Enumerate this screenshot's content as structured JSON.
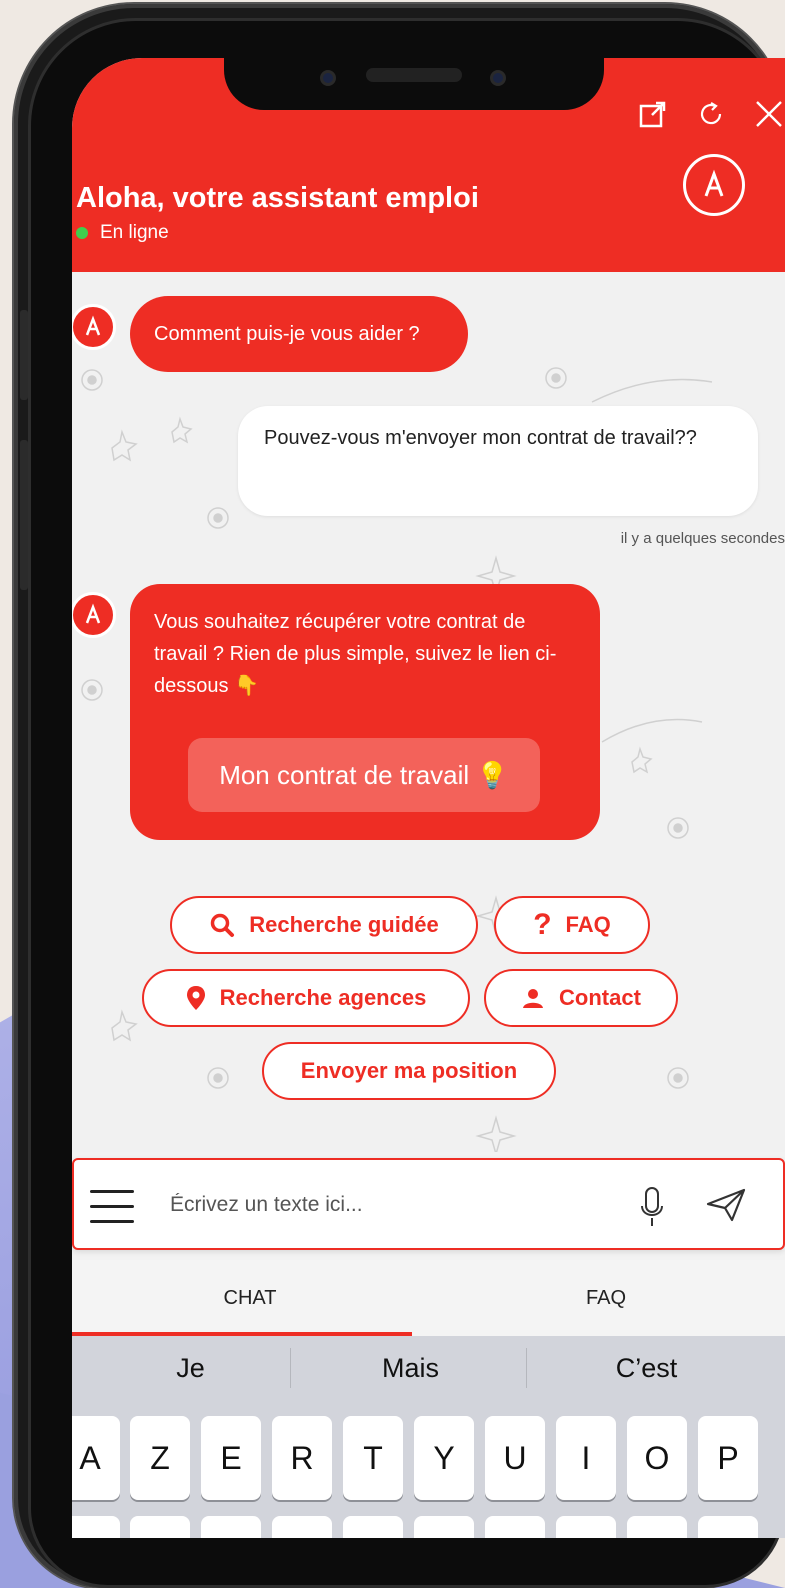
{
  "header": {
    "title": "Aloha, votre assistant emploi",
    "status": "En ligne",
    "icons": [
      "external-link-icon",
      "refresh-icon",
      "close-icon"
    ],
    "brand_color": "#ee2d24",
    "status_color": "#3fcf4d"
  },
  "messages": [
    {
      "from": "bot",
      "text": "Comment puis-je vous aider ?"
    },
    {
      "from": "user",
      "text": "Pouvez-vous m'envoyer mon contrat de travail??",
      "time": "il y a quelques secondes"
    },
    {
      "from": "bot",
      "text": "Vous souhaitez récupérer votre contrat de travail ? Rien de plus simple, suivez le lien ci-dessous 👇",
      "button": "Mon contrat de travail 💡"
    }
  ],
  "quick_replies": [
    {
      "label": "Recherche guidée",
      "icon": "search-icon"
    },
    {
      "label": "FAQ",
      "icon": "question-icon"
    },
    {
      "label": "Recherche agences",
      "icon": "location-pin-icon"
    },
    {
      "label": "Contact",
      "icon": "person-icon"
    },
    {
      "label": "Envoyer ma position",
      "icon": ""
    }
  ],
  "composer": {
    "placeholder": "Écrivez un texte ici..."
  },
  "tabs": [
    {
      "label": "CHAT",
      "active": true
    },
    {
      "label": "FAQ",
      "active": false
    }
  ],
  "keyboard": {
    "suggestions": [
      "Je",
      "Mais",
      "C’est"
    ],
    "row1": [
      "A",
      "Z",
      "E",
      "R",
      "T",
      "Y",
      "U",
      "I",
      "O",
      "P"
    ]
  }
}
